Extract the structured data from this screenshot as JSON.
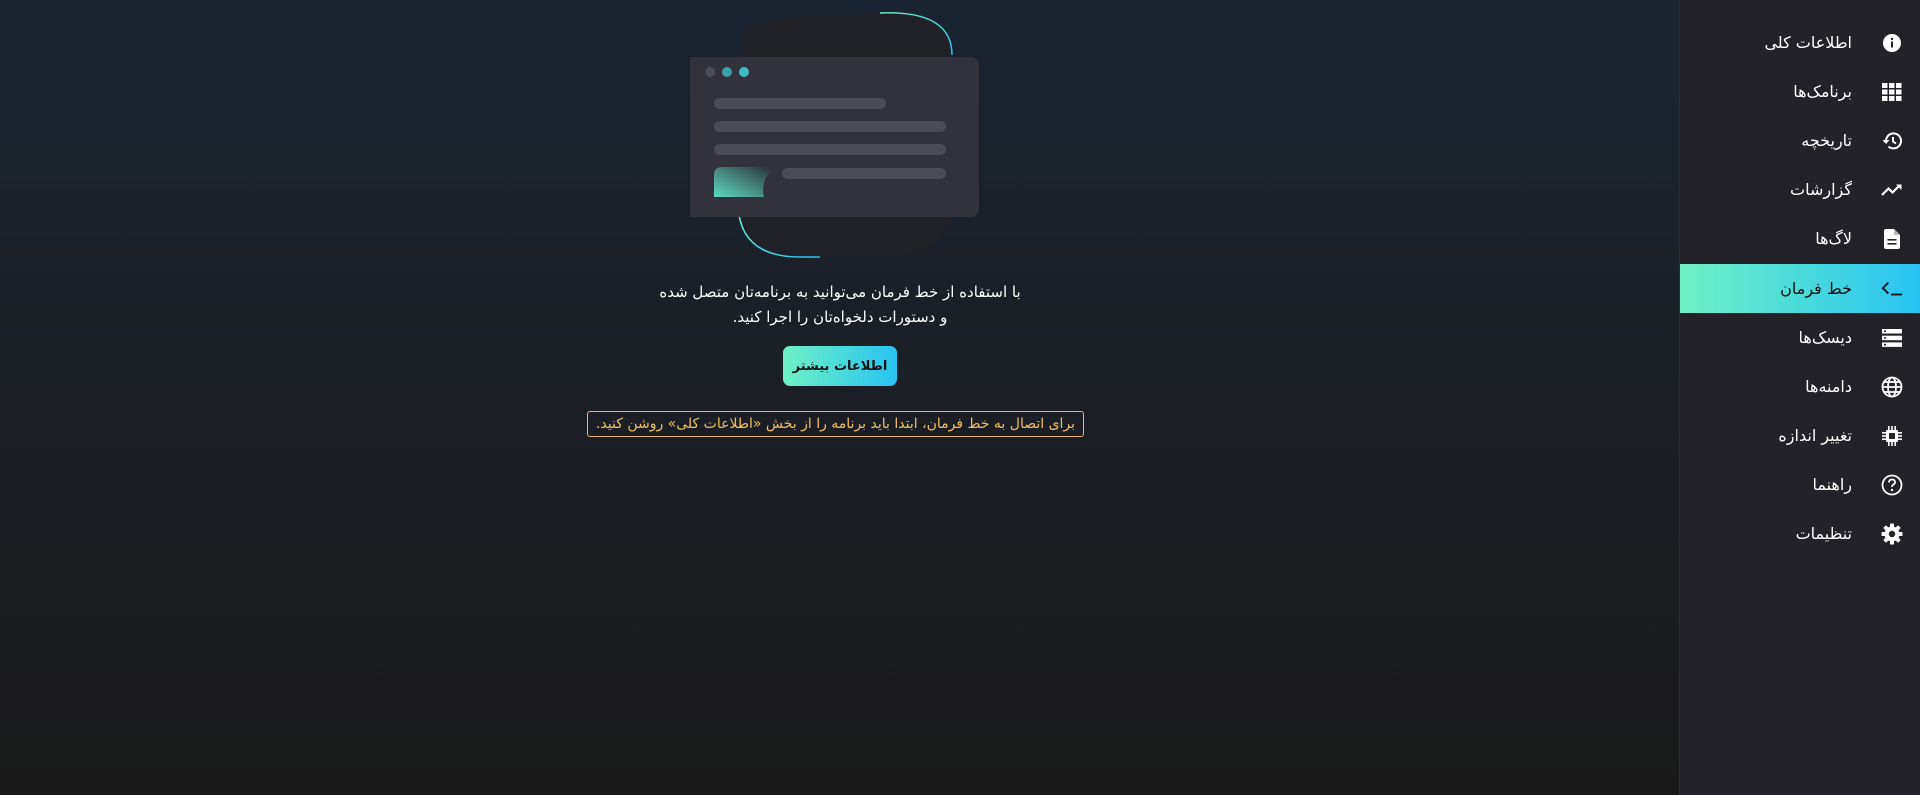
{
  "main": {
    "description_line1": "با استفاده از خط فرمان می‌توانید به برنامه‌تان متصل شده",
    "description_line2": "و دستورات دلخواه‌تان را اجرا کنید.",
    "more_button": "اطلاعات بیشتر",
    "warning": "برای اتصال به خط فرمان، ابتدا باید برنامه را از بخش «اطلاعات کلی» روشن کنید."
  },
  "sidebar": {
    "items": [
      {
        "label": "اطلاعات کلی",
        "icon": "info-icon"
      },
      {
        "label": "برنامک‌ها",
        "icon": "grid-icon"
      },
      {
        "label": "تاریخچه",
        "icon": "history-icon"
      },
      {
        "label": "گزارشات",
        "icon": "trend-icon"
      },
      {
        "label": "لاگ‌ها",
        "icon": "document-icon"
      },
      {
        "label": "خط فرمان",
        "icon": "terminal-icon",
        "active": true
      },
      {
        "label": "دیسک‌ها",
        "icon": "storage-icon"
      },
      {
        "label": "دامنه‌ها",
        "icon": "globe-icon"
      },
      {
        "label": "تغییر اندازه",
        "icon": "chip-icon"
      },
      {
        "label": "راهنما",
        "icon": "help-icon"
      },
      {
        "label": "تنظیمات",
        "icon": "gear-icon"
      }
    ]
  },
  "colors": {
    "accent_start": "#6ff1c4",
    "accent_end": "#28c3f2",
    "warning": "#f0c061",
    "sidebar_bg": "#222228"
  }
}
